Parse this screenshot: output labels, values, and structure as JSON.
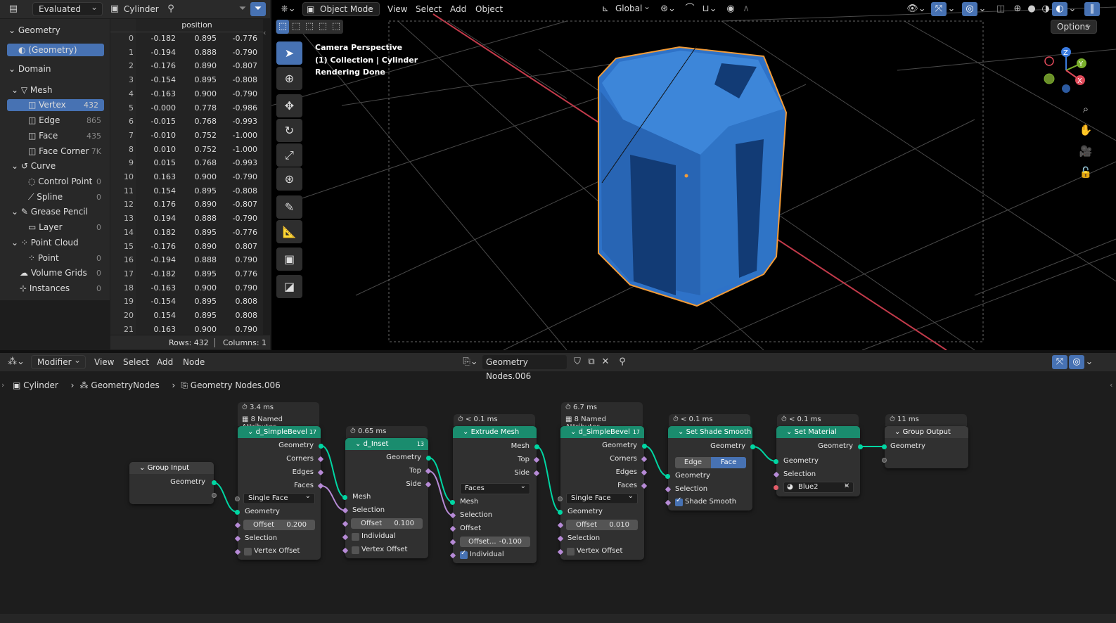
{
  "spreadsheet": {
    "mode": "Evaluated",
    "object": "Cylinder",
    "column_header": "position",
    "tree": {
      "geometry_header": "Geometry",
      "geometry_item": "(Geometry)",
      "domain_header": "Domain",
      "mesh": "Mesh",
      "vertex": {
        "label": "Vertex",
        "count": "432"
      },
      "edge": {
        "label": "Edge",
        "count": "865"
      },
      "face": {
        "label": "Face",
        "count": "435"
      },
      "face_corner": {
        "label": "Face Corner",
        "count": "7K"
      },
      "curve": "Curve",
      "control_point": {
        "label": "Control Point",
        "count": "0"
      },
      "spline": {
        "label": "Spline",
        "count": "0"
      },
      "grease_pencil": "Grease Pencil",
      "layer": {
        "label": "Layer",
        "count": "0"
      },
      "point_cloud": "Point Cloud",
      "point": {
        "label": "Point",
        "count": "0"
      },
      "volume_grids": {
        "label": "Volume Grids",
        "count": "0"
      },
      "instances": {
        "label": "Instances",
        "count": "0"
      }
    },
    "rows": [
      [
        "0",
        "-0.182",
        "0.895",
        "-0.776"
      ],
      [
        "1",
        "-0.194",
        "0.888",
        "-0.790"
      ],
      [
        "2",
        "-0.176",
        "0.890",
        "-0.807"
      ],
      [
        "3",
        "-0.154",
        "0.895",
        "-0.808"
      ],
      [
        "4",
        "-0.163",
        "0.900",
        "-0.790"
      ],
      [
        "5",
        "-0.000",
        "0.778",
        "-0.986"
      ],
      [
        "6",
        "-0.015",
        "0.768",
        "-0.993"
      ],
      [
        "7",
        "-0.010",
        "0.752",
        "-1.000"
      ],
      [
        "8",
        "0.010",
        "0.752",
        "-1.000"
      ],
      [
        "9",
        "0.015",
        "0.768",
        "-0.993"
      ],
      [
        "10",
        "0.163",
        "0.900",
        "-0.790"
      ],
      [
        "11",
        "0.154",
        "0.895",
        "-0.808"
      ],
      [
        "12",
        "0.176",
        "0.890",
        "-0.807"
      ],
      [
        "13",
        "0.194",
        "0.888",
        "-0.790"
      ],
      [
        "14",
        "0.182",
        "0.895",
        "-0.776"
      ],
      [
        "15",
        "-0.176",
        "0.890",
        "0.807"
      ],
      [
        "16",
        "-0.194",
        "0.888",
        "0.790"
      ],
      [
        "17",
        "-0.182",
        "0.895",
        "0.776"
      ],
      [
        "18",
        "-0.163",
        "0.900",
        "0.790"
      ],
      [
        "19",
        "-0.154",
        "0.895",
        "0.808"
      ],
      [
        "20",
        "0.154",
        "0.895",
        "0.808"
      ],
      [
        "21",
        "0.163",
        "0.900",
        "0.790"
      ]
    ],
    "footer": {
      "rows": "Rows: 432",
      "columns": "Columns: 1"
    }
  },
  "viewport": {
    "mode": "Object Mode",
    "menu": [
      "View",
      "Select",
      "Add",
      "Object"
    ],
    "orientation": "Global",
    "options": "Options",
    "overlay_text": [
      "Camera Perspective",
      "(1) Collection | Cylinder",
      "Rendering Done"
    ],
    "gizmo": {
      "x": "X",
      "y": "Y",
      "z": "Z"
    },
    "colors": {
      "object": "#2e72c8",
      "outline": "#f29b38",
      "x_axis": "#c23a4a"
    }
  },
  "node_editor": {
    "editor_type": "Modifier",
    "menu": [
      "View",
      "Select",
      "Add",
      "Node"
    ],
    "tree_name": "Geometry Nodes.006",
    "breadcrumb": [
      "Cylinder",
      "GeometryNodes",
      "Geometry Nodes.006"
    ],
    "nodes": {
      "group_input": {
        "title": "Group Input",
        "out": "Geometry"
      },
      "bevel1": {
        "time": "3.4 ms",
        "attrs": "8 Named Attributes",
        "title": "d_SimpleBevel",
        "badge": "17",
        "outs": [
          "Geometry",
          "Corners",
          "Edges",
          "Faces"
        ],
        "mode": "Single Face",
        "in_geo": "Geometry",
        "offset_label": "Offset",
        "offset": "0.200",
        "selection": "Selection",
        "vertex_offset": "Vertex Offset"
      },
      "inset": {
        "time": "0.65 ms",
        "title": "d_Inset",
        "badge": "13",
        "outs": [
          "Geometry",
          "Top",
          "Side"
        ],
        "mesh": "Mesh",
        "selection": "Selection",
        "offset_label": "Offset",
        "offset": "0.100",
        "individual": "Individual",
        "vertex_offset": "Vertex Offset"
      },
      "extrude": {
        "time": "< 0.1 ms",
        "title": "Extrude Mesh",
        "outs": [
          "Mesh",
          "Top",
          "Side"
        ],
        "mode": "Faces",
        "mesh": "Mesh",
        "selection": "Selection",
        "offset": "Offset",
        "offset_scale_label": "Offset...",
        "offset_scale": "-0.100",
        "individual": "Individual"
      },
      "bevel2": {
        "time": "6.7 ms",
        "attrs": "8 Named Attributes",
        "title": "d_SimpleBevel",
        "badge": "17",
        "outs": [
          "Geometry",
          "Corners",
          "Edges",
          "Faces"
        ],
        "mode": "Single Face",
        "in_geo": "Geometry",
        "offset_label": "Offset",
        "offset": "0.010",
        "selection": "Selection",
        "vertex_offset": "Vertex Offset"
      },
      "smooth": {
        "time": "< 0.1 ms",
        "title": "Set Shade Smooth",
        "out": "Geometry",
        "edge": "Edge",
        "face": "Face",
        "geometry": "Geometry",
        "selection": "Selection",
        "shade_smooth": "Shade Smooth"
      },
      "material": {
        "time": "< 0.1 ms",
        "title": "Set Material",
        "out": "Geometry",
        "geometry": "Geometry",
        "selection": "Selection",
        "material": "Blue2"
      },
      "output": {
        "time": "11 ms",
        "title": "Group Output",
        "geometry": "Geometry"
      }
    }
  }
}
